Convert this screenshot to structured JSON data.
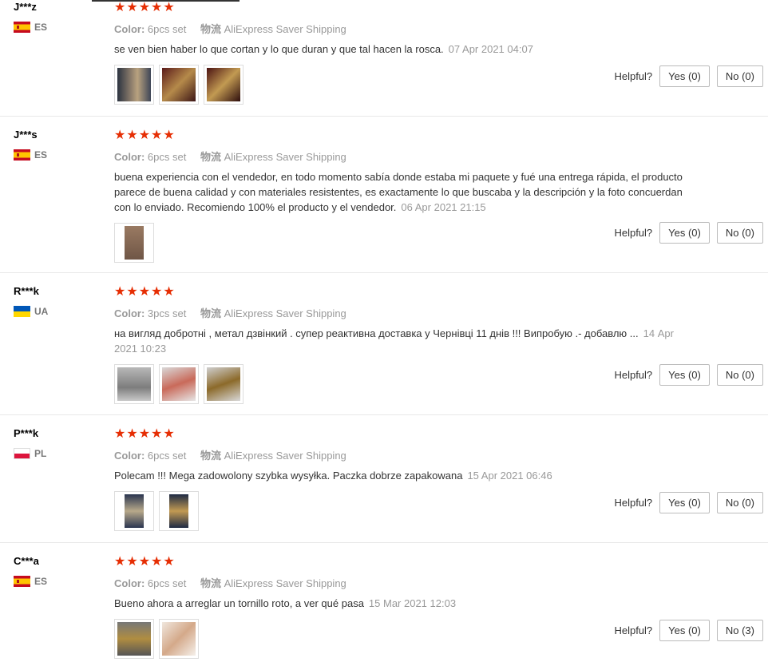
{
  "labels": {
    "color": "Color:",
    "logistics_cn": "物流",
    "helpful": "Helpful?"
  },
  "reviews": [
    {
      "user": "J***z",
      "country": "ES",
      "stars": "★★★★★",
      "color_value": "6pcs set",
      "shipping": "AliExpress Saver Shipping",
      "text": "se ven bien haber lo que cortan y lo que duran y que tal hacen la rosca.",
      "date": "07 Apr 2021 04:07",
      "yes": "Yes (0)",
      "no": "No (0)"
    },
    {
      "user": "J***s",
      "country": "ES",
      "stars": "★★★★★",
      "color_value": "6pcs set",
      "shipping": "AliExpress Saver Shipping",
      "text": "buena experiencia con el vendedor, en todo momento sabía donde estaba mi paquete y fué una entrega rápida, el producto parece de buena calidad y con materiales resistentes, es exactamente lo que buscaba y la descripción y la foto concuerdan con lo enviado. Recomiendo 100% el producto y el vendedor.",
      "date": "06 Apr 2021 21:15",
      "yes": "Yes (0)",
      "no": "No (0)"
    },
    {
      "user": "R***k",
      "country": "UA",
      "stars": "★★★★★",
      "color_value": "3pcs set",
      "shipping": "AliExpress Saver Shipping",
      "text": "на вигляд добротні , метал дзвінкий . супер реактивна доставка у Чернівці 11 днів !!! Випробую .- добавлю ...",
      "date": "14 Apr 2021 10:23",
      "yes": "Yes (0)",
      "no": "No (0)"
    },
    {
      "user": "P***k",
      "country": "PL",
      "stars": "★★★★★",
      "color_value": "6pcs set",
      "shipping": "AliExpress Saver Shipping",
      "text": "Polecam !!! Mega zadowolony szybka wysyłka. Paczka dobrze zapakowana",
      "date": "15 Apr 2021 06:46",
      "yes": "Yes (0)",
      "no": "No (0)"
    },
    {
      "user": "C***a",
      "country": "ES",
      "stars": "★★★★★",
      "color_value": "6pcs set",
      "shipping": "AliExpress Saver Shipping",
      "text": "Bueno ahora a arreglar un tornillo roto, a ver qué pasa",
      "date": "15 Mar 2021 12:03",
      "yes": "Yes (0)",
      "no": "No (3)"
    }
  ]
}
